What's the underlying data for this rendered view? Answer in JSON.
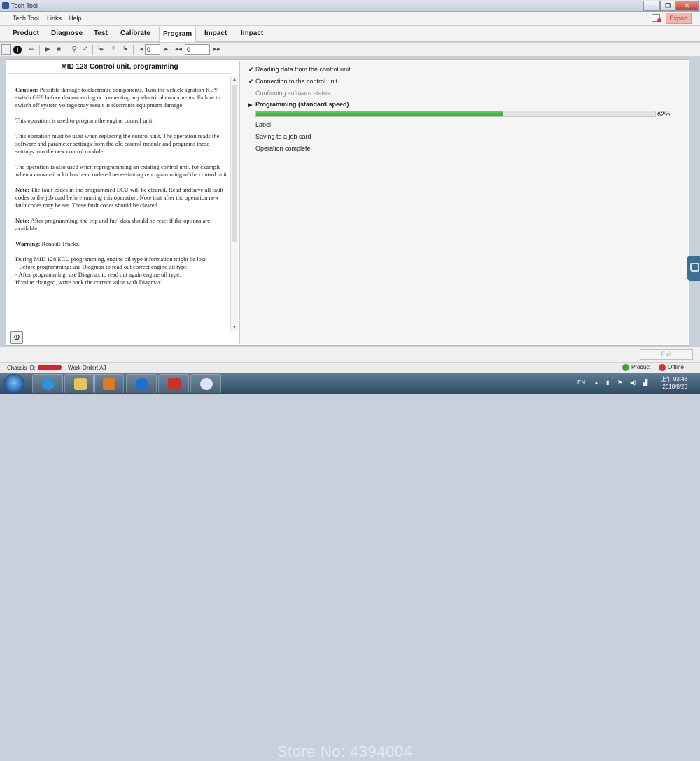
{
  "window": {
    "title": "Tech Tool",
    "minimize": "—",
    "restore": "❐",
    "close": "✕"
  },
  "menu": {
    "items": [
      "Tech Tool",
      "Links",
      "Help"
    ],
    "export_label": "Export"
  },
  "tabs": [
    {
      "label": "Product"
    },
    {
      "label": "Diagnose"
    },
    {
      "label": "Test"
    },
    {
      "label": "Calibrate"
    },
    {
      "label": "Program",
      "active": true
    },
    {
      "label": "Impact"
    },
    {
      "label": "Impact"
    }
  ],
  "toolbar": {
    "input1_value": "0",
    "input2_value": "0"
  },
  "doc": {
    "heading": "MID 128 Control unit, programming",
    "paragraphs": [
      {
        "bold": "Caution:",
        "text": " Possible damage to electronic components. Turn the vehicle ignition KEY switch OFF before disconnecting or connecting any electrical components. Failure to switch off system voltage may result in electronic equipment damage."
      },
      {
        "bold": "",
        "text": "This operation is used to program the engine control unit."
      },
      {
        "bold": "",
        "text": "This operation must be used when replacing the control unit. The operation reads the software and parameter settings from the old control module and programs these settings into the new control module."
      },
      {
        "bold": "",
        "text": "The operation is also used when reprogramming an existing control unit, for example when a conversion kit has been ordered necessitating reprogramming of the control unit."
      },
      {
        "bold": "Note:",
        "text": " The fault codes in the programmed ECU will be cleared. Read and save all fault codes to the job card before running this operation. Note that after the operation new fault codes may be set. These fault codes should be cleared."
      },
      {
        "bold": "Note:",
        "text": " After programming, the trip and fuel data should be reset if the options are available."
      },
      {
        "bold": "Warning:",
        "text": " Renault Trucks."
      },
      {
        "bold": "",
        "text": "During MID 128 ECU programming, engine oil type information might be lost:\n- Before programming: use Diagmax to read out correct engine oil type.\n- After programming: use Diagmax to read out again engine oil type.\nIf value changed, write back the correct value with Diagmax."
      }
    ]
  },
  "steps": [
    {
      "label": "Reading data from the control unit",
      "state": "done",
      "mark": "✔"
    },
    {
      "label": "Connection to the control unit",
      "state": "done",
      "mark": "✔"
    },
    {
      "label": "Confirming software status",
      "state": "dim",
      "mark": ""
    },
    {
      "label": "Programming  (standard speed)",
      "state": "active",
      "mark": "▶"
    },
    {
      "label": "Label",
      "state": "pending",
      "mark": ""
    },
    {
      "label": "Saving to a job card",
      "state": "pending",
      "mark": ""
    },
    {
      "label": "Operation complete",
      "state": "pending",
      "mark": ""
    }
  ],
  "progress": {
    "value": 0.62,
    "label": "62%"
  },
  "footer": {
    "exit_label": "Exit"
  },
  "status": {
    "chassis_label": "Chassis ID:",
    "work_order": "Work Order: AJ",
    "product_label": "Product",
    "offline_label": "Offline",
    "colors": {
      "product": "#3aa63a",
      "offline": "#d93030"
    }
  },
  "taskbar": {
    "watermark": "Store No: 4394004",
    "lang": "EN",
    "time": "上午 03:48",
    "date": "2018/8/26"
  }
}
